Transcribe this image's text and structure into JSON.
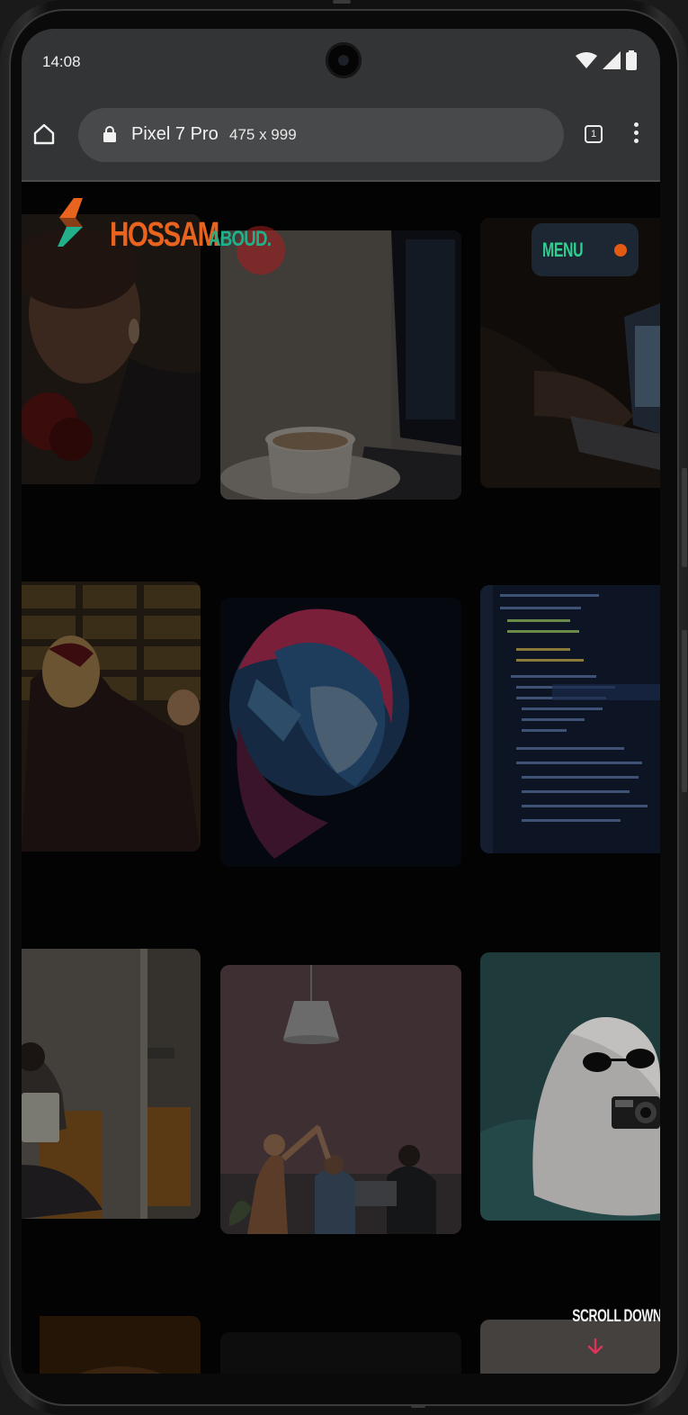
{
  "status_bar": {
    "time": "14:08"
  },
  "browser": {
    "device_name": "Pixel 7 Pro",
    "device_dimensions": "475 x 999",
    "tab_count": "1"
  },
  "site": {
    "logo": {
      "primary": "HOSSAM",
      "secondary": "ABOUD."
    },
    "menu": {
      "label": "MENU"
    },
    "scroll_hint": "SCROLL DOWN"
  },
  "gallery": [
    {
      "name": "portrait-with-flowers-photo",
      "subject": "portrait"
    },
    {
      "name": "coffee-cup-laptop-photo",
      "subject": "coffee and laptop"
    },
    {
      "name": "typing-on-laptop-photo",
      "subject": "typing on laptop"
    },
    {
      "name": "woman-lockers-photo",
      "subject": "woman at lockers"
    },
    {
      "name": "astronaut-helmet-photo",
      "subject": "astronaut helmet"
    },
    {
      "name": "code-screen-photo",
      "subject": "code on screen"
    },
    {
      "name": "person-on-sofa-photo",
      "subject": "person on sofa"
    },
    {
      "name": "team-high-five-photo",
      "subject": "team high five"
    },
    {
      "name": "ghost-with-camera-photo",
      "subject": "ghost with camera"
    },
    {
      "name": "dark-image-tile-left",
      "subject": "partial image"
    },
    {
      "name": "dark-image-tile-center",
      "subject": "partial image"
    },
    {
      "name": "gray-image-tile-right",
      "subject": "partial image"
    }
  ],
  "colors": {
    "accent_orange": "#e8631e",
    "accent_green": "#21b08a",
    "menu_bg": "#1c2733",
    "scroll_arrow": "#e0335a"
  }
}
